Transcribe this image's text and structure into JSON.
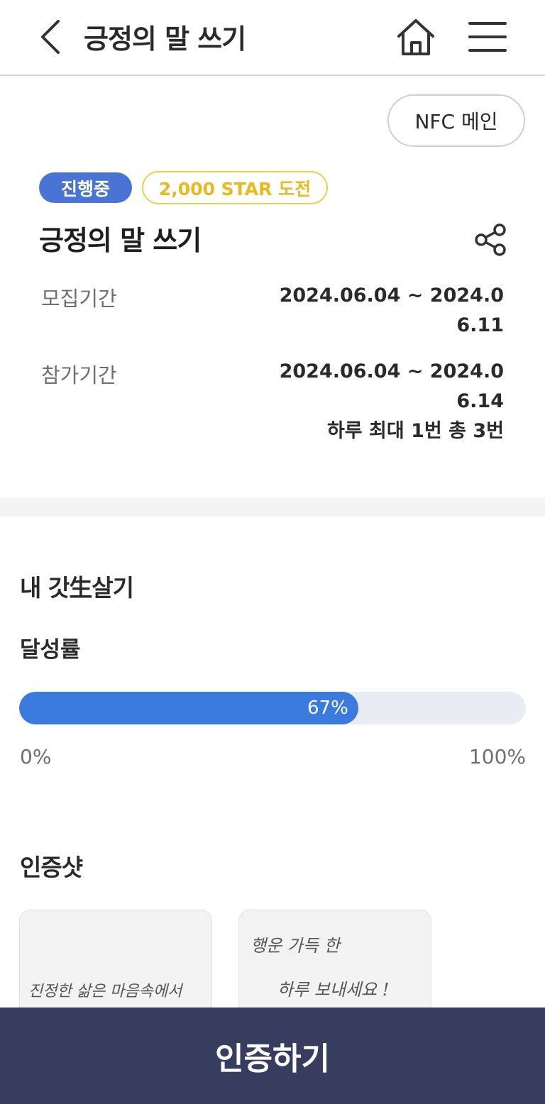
{
  "header": {
    "title": "긍정의 말 쓰기",
    "back_icon": "chevron-left-icon",
    "home_icon": "home-icon",
    "menu_icon": "hamburger-menu-icon"
  },
  "nfc_button": {
    "label": "NFC 메인"
  },
  "challenge": {
    "status_badge": "진행중",
    "star_badge": "2,000 STAR 도전",
    "title": "긍정의 말 쓰기",
    "share_icon": "share-icon",
    "recruit": {
      "label": "모집기간",
      "value": "2024.06.04 ~ 2024.06.11"
    },
    "participate": {
      "label": "참가기간",
      "value": "2024.06.04 ~ 2024.06.14",
      "note": "하루 최대 1번 총 3번"
    }
  },
  "my_life": {
    "title": "내 갓生살기",
    "rate_label": "달성률",
    "progress_text": "67%",
    "progress_fraction": 0.67,
    "min_label": "0%",
    "max_label": "100%"
  },
  "proof": {
    "title": "인증샷",
    "photos": [
      {
        "caption": "진정한 삶은 마음속에서"
      },
      {
        "line1": "행운 가득 한",
        "line2": "하루 보내세요 !"
      }
    ]
  },
  "cta": {
    "label": "인증하기"
  },
  "colors": {
    "accent_blue": "#4a74d4",
    "progress_blue": "#3b7be0",
    "star_yellow": "#e8ba1d",
    "cta_navy": "#373d5f"
  }
}
